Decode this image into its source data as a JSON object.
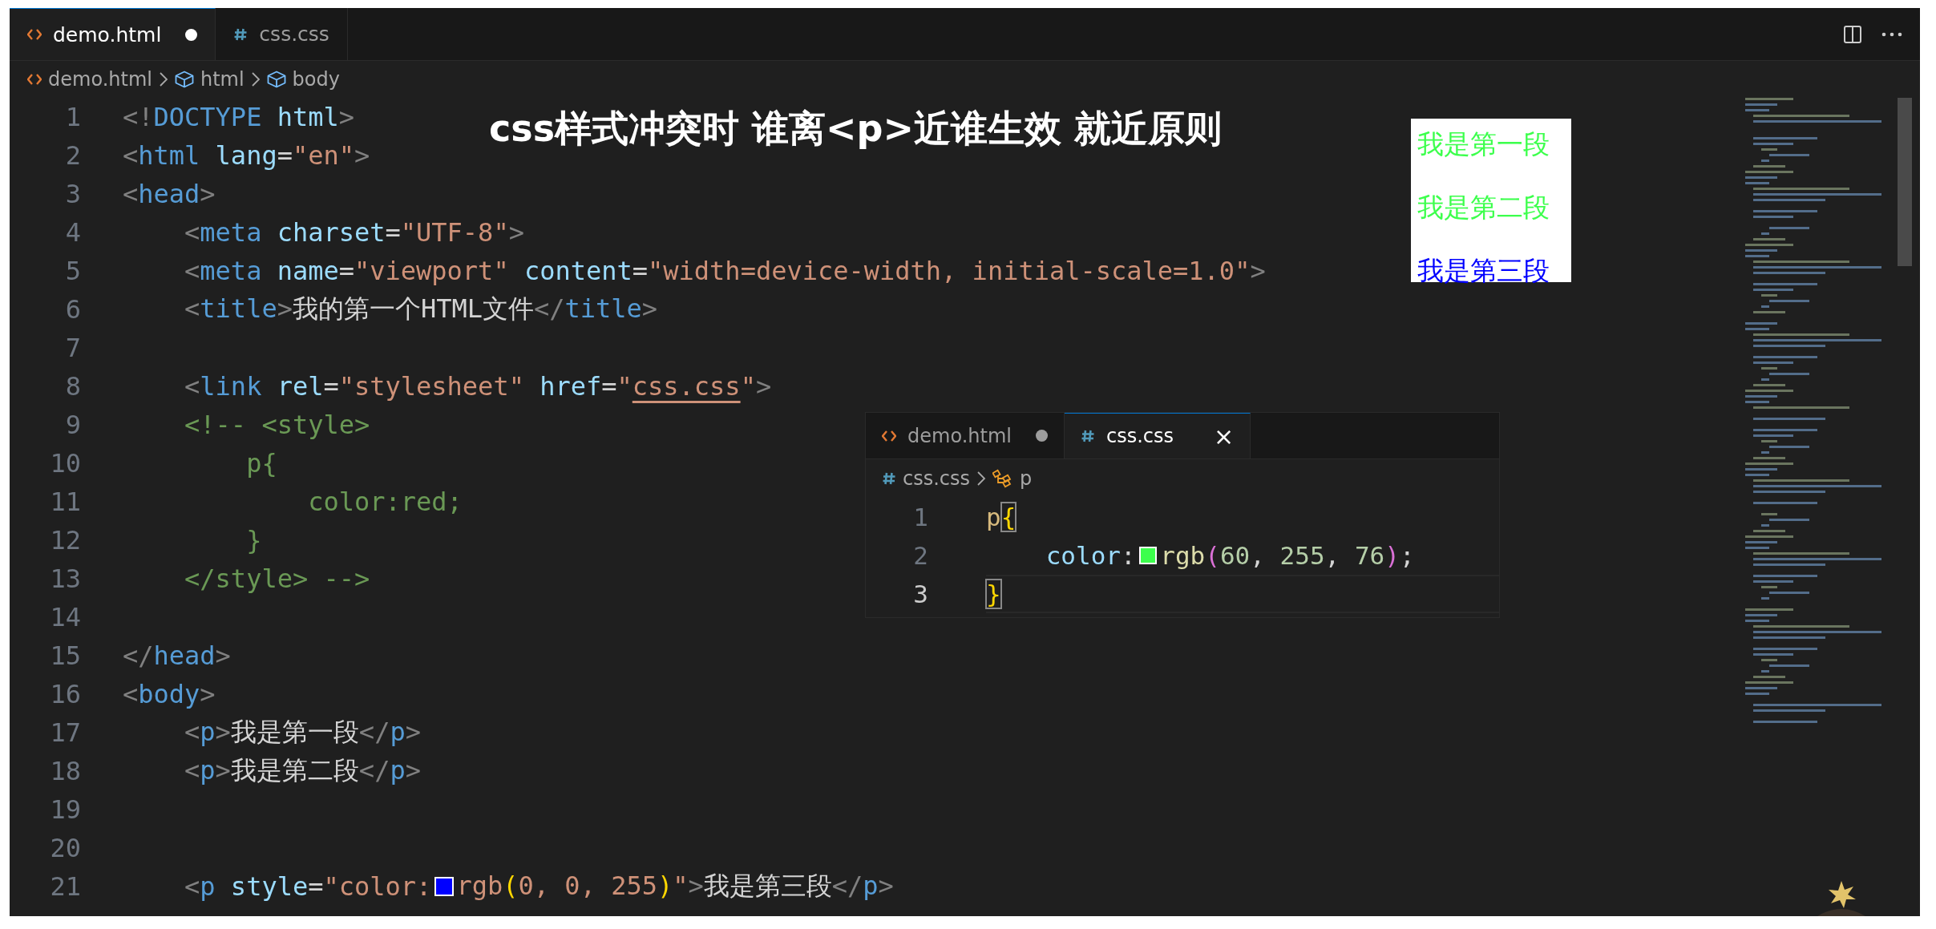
{
  "tabs": [
    {
      "label": "demo.html",
      "kind": "html",
      "selected": true,
      "dirty": true
    },
    {
      "label": "css.css",
      "kind": "css",
      "selected": false,
      "dirty": false
    }
  ],
  "breadcrumb": [
    {
      "label": "demo.html",
      "kind": "html"
    },
    {
      "label": "html",
      "kind": "element"
    },
    {
      "label": "body",
      "kind": "element"
    }
  ],
  "lines": [
    {
      "number": "1",
      "tokens": [
        {
          "kind": "punct",
          "text": "<!"
        },
        {
          "kind": "tag",
          "text": "DOCTYPE"
        },
        {
          "kind": "attr",
          "text": " html"
        },
        {
          "kind": "punct",
          "text": ">"
        }
      ]
    },
    {
      "number": "2",
      "tokens": [
        {
          "kind": "punct",
          "text": "<"
        },
        {
          "kind": "tag",
          "text": "html"
        },
        {
          "kind": "attr",
          "text": " lang"
        },
        {
          "kind": "text",
          "text": "="
        },
        {
          "kind": "string",
          "text": "\"en\""
        },
        {
          "kind": "punct",
          "text": ">"
        }
      ]
    },
    {
      "number": "3",
      "tokens": [
        {
          "kind": "punct",
          "text": "<"
        },
        {
          "kind": "tag",
          "text": "head"
        },
        {
          "kind": "punct",
          "text": ">"
        }
      ]
    },
    {
      "number": "4",
      "tokens": [
        {
          "kind": "punct",
          "text": "    <"
        },
        {
          "kind": "tag",
          "text": "meta"
        },
        {
          "kind": "attr",
          "text": " charset"
        },
        {
          "kind": "text",
          "text": "="
        },
        {
          "kind": "string",
          "text": "\"UTF-8\""
        },
        {
          "kind": "punct",
          "text": ">"
        }
      ]
    },
    {
      "number": "5",
      "tokens": [
        {
          "kind": "punct",
          "text": "    <"
        },
        {
          "kind": "tag",
          "text": "meta"
        },
        {
          "kind": "attr",
          "text": " name"
        },
        {
          "kind": "text",
          "text": "="
        },
        {
          "kind": "string",
          "text": "\"viewport\""
        },
        {
          "kind": "attr",
          "text": " content"
        },
        {
          "kind": "text",
          "text": "="
        },
        {
          "kind": "string",
          "text": "\"width=device-width, initial-scale=1.0\""
        },
        {
          "kind": "punct",
          "text": ">"
        }
      ]
    },
    {
      "number": "6",
      "tokens": [
        {
          "kind": "punct",
          "text": "    <"
        },
        {
          "kind": "tag",
          "text": "title"
        },
        {
          "kind": "punct",
          "text": ">"
        },
        {
          "kind": "text",
          "text": "我的第一个HTML文件"
        },
        {
          "kind": "punct",
          "text": "</"
        },
        {
          "kind": "tag",
          "text": "title"
        },
        {
          "kind": "punct",
          "text": ">"
        }
      ]
    },
    {
      "number": "7"
    },
    {
      "number": "8",
      "tokens": [
        {
          "kind": "punct",
          "text": "    <"
        },
        {
          "kind": "tag",
          "text": "link"
        },
        {
          "kind": "attr",
          "text": " rel"
        },
        {
          "kind": "text",
          "text": "="
        },
        {
          "kind": "string",
          "text": "\"stylesheet\""
        },
        {
          "kind": "attr",
          "text": " href"
        },
        {
          "kind": "text",
          "text": "="
        },
        {
          "kind": "string",
          "text": "\""
        },
        {
          "kind": "link",
          "text": "css.css"
        },
        {
          "kind": "string",
          "text": "\""
        },
        {
          "kind": "punct",
          "text": ">"
        }
      ]
    },
    {
      "number": "9",
      "tokens": [
        {
          "kind": "comment",
          "text": "    <!-- <style>"
        }
      ]
    },
    {
      "number": "10",
      "tokens": [
        {
          "kind": "comment",
          "text": "        p{"
        }
      ]
    },
    {
      "number": "11",
      "tokens": [
        {
          "kind": "comment",
          "text": "            color:red;"
        }
      ]
    },
    {
      "number": "12",
      "tokens": [
        {
          "kind": "comment",
          "text": "        }"
        }
      ]
    },
    {
      "number": "13",
      "tokens": [
        {
          "kind": "comment",
          "text": "    </style> -->"
        }
      ]
    },
    {
      "number": "14"
    },
    {
      "number": "15",
      "tokens": [
        {
          "kind": "punct",
          "text": "</"
        },
        {
          "kind": "tag",
          "text": "head"
        },
        {
          "kind": "punct",
          "text": ">"
        }
      ]
    },
    {
      "number": "16",
      "tokens": [
        {
          "kind": "punct",
          "text": "<"
        },
        {
          "kind": "tag",
          "text": "body"
        },
        {
          "kind": "punct",
          "text": ">"
        }
      ]
    },
    {
      "number": "17",
      "tokens": [
        {
          "kind": "punct",
          "text": "    <"
        },
        {
          "kind": "tag",
          "text": "p"
        },
        {
          "kind": "punct",
          "text": ">"
        },
        {
          "kind": "text",
          "text": "我是第一段"
        },
        {
          "kind": "punct",
          "text": "</"
        },
        {
          "kind": "tag",
          "text": "p"
        },
        {
          "kind": "punct",
          "text": ">"
        }
      ]
    },
    {
      "number": "18",
      "tokens": [
        {
          "kind": "punct",
          "text": "    <"
        },
        {
          "kind": "tag",
          "text": "p"
        },
        {
          "kind": "punct",
          "text": ">"
        },
        {
          "kind": "text",
          "text": "我是第二段"
        },
        {
          "kind": "punct",
          "text": "</"
        },
        {
          "kind": "tag",
          "text": "p"
        },
        {
          "kind": "punct",
          "text": ">"
        }
      ]
    },
    {
      "number": "19"
    },
    {
      "number": "20"
    },
    {
      "number": "21",
      "tokens": [
        {
          "kind": "punct",
          "text": "    <"
        },
        {
          "kind": "tag",
          "text": "p"
        },
        {
          "kind": "attr",
          "text": " style"
        },
        {
          "kind": "text",
          "text": "="
        },
        {
          "kind": "string",
          "text": "\"color:"
        },
        {
          "kind": "swatch",
          "color": "#0000ff"
        },
        {
          "kind": "string",
          "text": "rgb"
        },
        {
          "kind": "bracket",
          "text": "("
        },
        {
          "kind": "string",
          "text": "0, 0, 255"
        },
        {
          "kind": "bracket",
          "text": ")"
        },
        {
          "kind": "string",
          "text": "\""
        },
        {
          "kind": "punct",
          "text": ">"
        },
        {
          "kind": "text",
          "text": "我是第三段"
        },
        {
          "kind": "punct",
          "text": "</"
        },
        {
          "kind": "tag",
          "text": "p"
        },
        {
          "kind": "punct",
          "text": ">"
        }
      ]
    }
  ],
  "overlay_title": "css样式冲突时 谁离<p>近谁生效 就近原则",
  "preview": [
    {
      "text": "我是第一段",
      "color": "#3cff4c"
    },
    {
      "text": "我是第二段",
      "color": "#3cff4c"
    },
    {
      "text": "我是第三段",
      "color": "#0000ff"
    }
  ],
  "inner_editor": {
    "tabs": [
      {
        "label": "demo.html",
        "kind": "html",
        "selected": false,
        "dirty": true
      },
      {
        "label": "css.css",
        "kind": "css",
        "selected": true,
        "dirty": false,
        "close": "×"
      }
    ],
    "breadcrumb": [
      {
        "label": "css.css",
        "kind": "css"
      },
      {
        "label": "p",
        "kind": "selector"
      }
    ],
    "lines": [
      {
        "number": "1",
        "active": false,
        "tokens": [
          {
            "kind": "selector",
            "text": "p"
          },
          {
            "kind": "brace_match",
            "text": "{"
          }
        ]
      },
      {
        "number": "2",
        "active": false,
        "tokens": [
          {
            "kind": "prop",
            "text": "    color"
          },
          {
            "kind": "text",
            "text": ":"
          },
          {
            "kind": "swatch",
            "color": "#3cff4c"
          },
          {
            "kind": "func",
            "text": "rgb"
          },
          {
            "kind": "paren",
            "text": "("
          },
          {
            "kind": "number",
            "text": "60"
          },
          {
            "kind": "text",
            "text": ", "
          },
          {
            "kind": "number",
            "text": "255"
          },
          {
            "kind": "text",
            "text": ", "
          },
          {
            "kind": "number",
            "text": "76"
          },
          {
            "kind": "paren",
            "text": ")"
          },
          {
            "kind": "text",
            "text": ";"
          }
        ]
      },
      {
        "number": "3",
        "active": true,
        "tokens": [
          {
            "kind": "brace_match",
            "text": "}"
          }
        ]
      }
    ]
  }
}
